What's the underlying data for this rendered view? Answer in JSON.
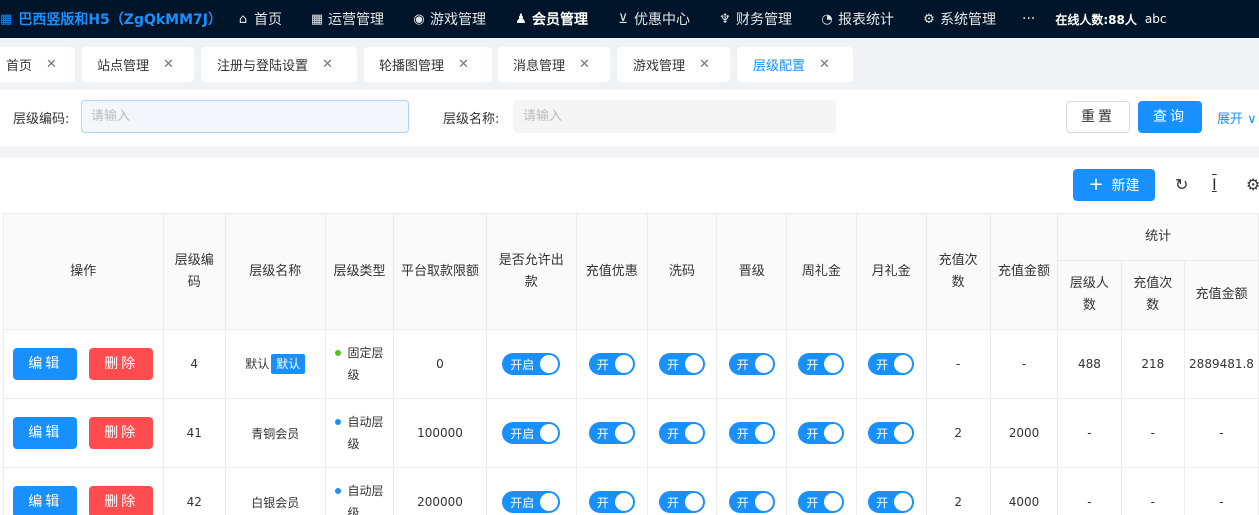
{
  "nav": {
    "brand": "巴西竖版和H5（ZgQkMM7J）",
    "items": [
      {
        "label": "首页",
        "icon": "home-icon",
        "glyph": "⌂"
      },
      {
        "label": "运营管理",
        "icon": "grid-icon",
        "glyph": "▦"
      },
      {
        "label": "游戏管理",
        "icon": "gamepad-icon",
        "glyph": "◉"
      },
      {
        "label": "会员管理",
        "icon": "users-icon",
        "glyph": "♟"
      },
      {
        "label": "优惠中心",
        "icon": "cart-icon",
        "glyph": "⊻"
      },
      {
        "label": "财务管理",
        "icon": "finance-icon",
        "glyph": "♆"
      },
      {
        "label": "报表统计",
        "icon": "pie-chart-icon",
        "glyph": "◔"
      },
      {
        "label": "系统管理",
        "icon": "gear-icon",
        "glyph": "⚙"
      }
    ],
    "more": "···",
    "online": "在线人数:88人",
    "user": "abc"
  },
  "tabs": [
    {
      "label": "首页"
    },
    {
      "label": "站点管理"
    },
    {
      "label": "注册与登陆设置"
    },
    {
      "label": "轮播图管理"
    },
    {
      "label": "消息管理"
    },
    {
      "label": "游戏管理"
    },
    {
      "label": "层级配置"
    }
  ],
  "search": {
    "code_label": "层级编码:",
    "code_placeholder": "请输入",
    "name_label": "层级名称:",
    "name_placeholder": "请输入",
    "reset": "重置",
    "query": "查询",
    "expand": "展开 ∨"
  },
  "toolbar": {
    "new": "新建",
    "plus": "+",
    "refresh_glyph": "↻",
    "density_glyph": "Ι",
    "settings_glyph": "⚙"
  },
  "table": {
    "headers": {
      "op": "操作",
      "code": "层级编码",
      "name": "层级名称",
      "type": "层级类型",
      "limit": "平台取款限额",
      "allow": "是否允许出款",
      "recharge_promo": "充值优惠",
      "wash": "洗码",
      "promote": "晋级",
      "weekly": "周礼金",
      "monthly": "月礼金",
      "recharge_count": "充值次数",
      "recharge_amount": "充值金额",
      "stats": "统计",
      "stat_members": "层级人数",
      "stat_count": "充值次数",
      "stat_amount": "充值金额"
    },
    "edit": "编辑",
    "delete": "删除",
    "switch_allow": "开启",
    "switch_on": "开",
    "rows": [
      {
        "code": "4",
        "name": "默认",
        "tag": "默认",
        "type": "固定层级",
        "type_color": "#52c41a",
        "limit": "0",
        "recharge_count": "-",
        "recharge_amount": "-",
        "stat_members": "488",
        "stat_count": "218",
        "stat_amount": "2889481.8"
      },
      {
        "code": "41",
        "name": "青铜会员",
        "tag": "",
        "type": "自动层级",
        "type_color": "#1890ff",
        "limit": "100000",
        "recharge_count": "2",
        "recharge_amount": "2000",
        "stat_members": "-",
        "stat_count": "-",
        "stat_amount": "-"
      },
      {
        "code": "42",
        "name": "白银会员",
        "tag": "",
        "type": "自动层级",
        "type_color": "#1890ff",
        "limit": "200000",
        "recharge_count": "2",
        "recharge_amount": "4000",
        "stat_members": "-",
        "stat_count": "-",
        "stat_amount": "-"
      }
    ]
  }
}
